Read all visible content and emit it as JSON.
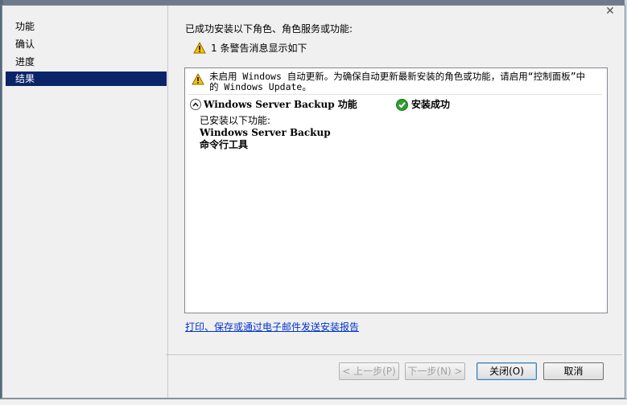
{
  "sidebar": {
    "items": [
      {
        "label": "功能"
      },
      {
        "label": "确认"
      },
      {
        "label": "进度"
      },
      {
        "label": "结果",
        "active": true
      }
    ]
  },
  "main": {
    "headline": "已成功安装以下角色、角色服务或功能:",
    "warning_summary": "1 条警告消息显示如下",
    "notice_line1": "未启用 Windows 自动更新。为确保自动更新最新安装的角色或功能，请启用“控制面板”中",
    "notice_line2": "的 Windows Update。",
    "feature": {
      "name": "Windows Server Backup 功能",
      "status": "安装成功",
      "installed_header": "已安装以下功能:",
      "installed_items": [
        "Windows Server Backup",
        "命令行工具"
      ]
    },
    "report_link": "打印、保存或通过电子邮件发送安装报告"
  },
  "buttons": {
    "back": "< 上一步(P)",
    "next": "下一步(N) >",
    "close": "关闭(O)",
    "cancel": "取消"
  },
  "icons": {
    "warning": "warning-triangle-icon",
    "success": "check-circle-icon",
    "collapse": "chevron-up-icon",
    "close": "close-icon"
  },
  "colors": {
    "selected_nav": "#0a246a",
    "link": "#0033cc",
    "success_green": "#2e9e2e",
    "warning_yellow": "#f5c400"
  }
}
